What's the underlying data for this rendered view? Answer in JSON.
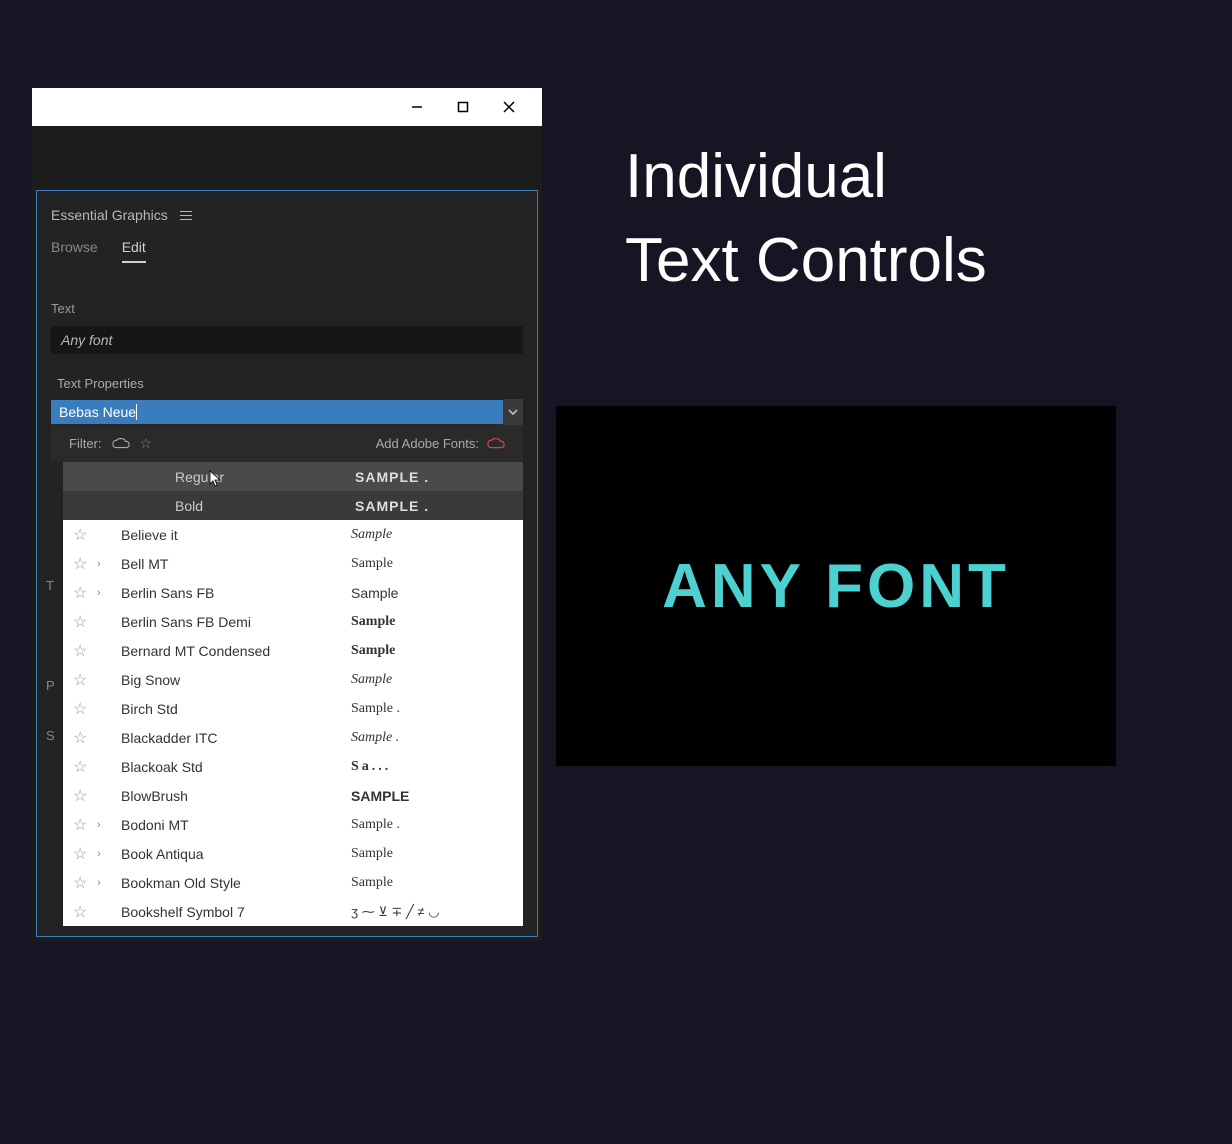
{
  "heading": {
    "line1": "Individual",
    "line2": "Text Controls"
  },
  "preview": {
    "text": "ANY FONT"
  },
  "window": {
    "panel_title": "Essential Graphics",
    "tabs": {
      "browse": "Browse",
      "edit": "Edit"
    },
    "text_section": "Text",
    "text_value": "Any font",
    "props_label": "Text Properties",
    "font_input_value": "Bebas Neue",
    "filter_label": "Filter:",
    "add_fonts_label": "Add Adobe Fonts:",
    "styles": [
      {
        "name": "Regular",
        "sample": "SAMPLE ."
      },
      {
        "name": "Bold",
        "sample": "SAMPLE ."
      }
    ],
    "fonts": [
      {
        "name": "Believe it",
        "sample": "Sample",
        "expandable": false,
        "sampleClass": "sample-script"
      },
      {
        "name": "Bell MT",
        "sample": "Sample",
        "expandable": true,
        "sampleClass": "sample-serif"
      },
      {
        "name": "Berlin Sans FB",
        "sample": "Sample",
        "expandable": true,
        "sampleClass": ""
      },
      {
        "name": "Berlin Sans FB Demi",
        "sample": "Sample",
        "expandable": false,
        "sampleClass": "sample-bold"
      },
      {
        "name": "Bernard MT Condensed",
        "sample": "Sample",
        "expandable": false,
        "sampleClass": "sample-condensed"
      },
      {
        "name": "Big Snow",
        "sample": "Sample",
        "expandable": false,
        "sampleClass": "sample-script"
      },
      {
        "name": "Birch Std",
        "sample": "Sample  .",
        "expandable": false,
        "sampleClass": "sample-serif"
      },
      {
        "name": "Blackadder ITC",
        "sample": "Sample .",
        "expandable": false,
        "sampleClass": "sample-script"
      },
      {
        "name": "Blackoak Std",
        "sample": "Sa...",
        "expandable": false,
        "sampleClass": "sample-wide"
      },
      {
        "name": "BlowBrush",
        "sample": "SAMPLE",
        "expandable": false,
        "sampleClass": "sample-brush"
      },
      {
        "name": "Bodoni MT",
        "sample": "Sample  .",
        "expandable": true,
        "sampleClass": "sample-serif"
      },
      {
        "name": "Book Antiqua",
        "sample": "Sample",
        "expandable": true,
        "sampleClass": "sample-serif"
      },
      {
        "name": "Bookman Old Style",
        "sample": "Sample",
        "expandable": true,
        "sampleClass": "sample-serif"
      },
      {
        "name": "Bookshelf Symbol 7",
        "sample": "ʒ ⁓ ⊻ ∓ ╱ ≠ ◡",
        "expandable": false,
        "sampleClass": "sample-symbol"
      }
    ],
    "left_hints": {
      "t": "T",
      "p": "P",
      "s": "S"
    }
  }
}
